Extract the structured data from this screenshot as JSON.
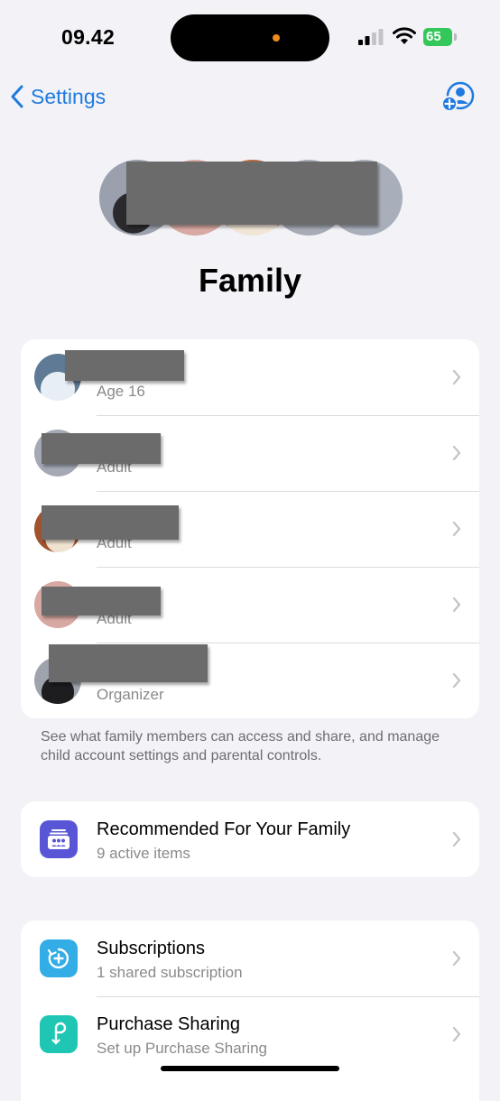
{
  "status_bar": {
    "time": "09.42",
    "battery_level": "65",
    "battery_color": "#34c759",
    "icons": [
      "cellular-signal-icon",
      "wifi-icon",
      "battery-charging-icon"
    ]
  },
  "nav": {
    "back_label": "Settings",
    "back_icon": "chevron-left-icon",
    "action_icon": "add-person-icon",
    "accent": "#1f7ae0"
  },
  "page": {
    "title": "Family"
  },
  "members": [
    {
      "name": "",
      "role": "Age 16"
    },
    {
      "name": "",
      "role": "Adult"
    },
    {
      "name": "",
      "role": "Adult"
    },
    {
      "name": "",
      "role": "Adult"
    },
    {
      "name": "",
      "role": "Organizer"
    }
  ],
  "footnote": "See what family members can access and share, and manage child account settings and parental controls.",
  "recommended": {
    "title": "Recommended For Your Family",
    "subtitle": "9 active items",
    "icon": "family-checklist-icon",
    "icon_color": "#5856d6"
  },
  "services": [
    {
      "title": "Subscriptions",
      "subtitle": "1 shared subscription",
      "icon": "subscriptions-icon",
      "icon_color": "#32ade6"
    },
    {
      "title": "Purchase Sharing",
      "subtitle": "Set up Purchase Sharing",
      "icon": "purchase-sharing-icon",
      "icon_color": "#1ec6b3"
    }
  ]
}
